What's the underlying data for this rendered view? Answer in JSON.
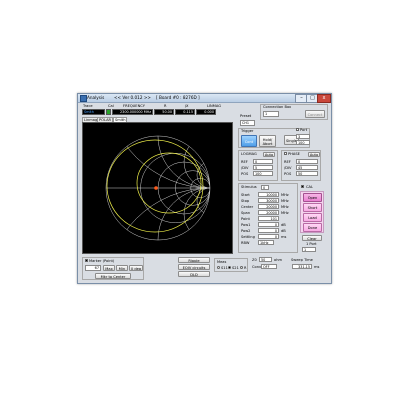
{
  "window": {
    "title": "Analysis",
    "version": "<< Ver 0.012 >>",
    "board": "[ Board #0 : 8276D ]",
    "minimize": "–",
    "maximize": "□",
    "close": "x"
  },
  "readout": {
    "headers": [
      "Trace",
      "Cal",
      "FREQUENCY",
      "R",
      "jX",
      "LINMAG"
    ],
    "values": [
      "Smith",
      "",
      "2300.000000 MHz",
      "50.00",
      "0.115",
      "0.000"
    ]
  },
  "tabs": [
    "Linmag",
    "POLAR",
    "Smith"
  ],
  "connection_box": {
    "title": "Connection Box",
    "select_value": "1",
    "button": "Connect"
  },
  "preset": {
    "label": "Preset",
    "value": "CH1"
  },
  "trigger": {
    "title": "Trigger",
    "cont": "Cont",
    "hold": "Hold/ Abort",
    "single": "Single",
    "port_label": "Port",
    "count": "3",
    "count2": "100"
  },
  "logmag": {
    "title": "LOGMAG",
    "auto": "Auto",
    "ref_label": "REF",
    "ref_value": "0",
    "div_label": "/DIV",
    "div_value": "5",
    "pos_label": "POS",
    "pos_value": "100"
  },
  "phase": {
    "title": "PHASE",
    "auto": "Auto",
    "ref_label": "REF",
    "ref_value": "0",
    "div_label": "/DIV",
    "div_value": "45",
    "pos_label": "POS",
    "pos_value": "50"
  },
  "stimulus": {
    "title": "Stimulus",
    "select_value": "0",
    "rows": [
      {
        "label": "Start",
        "value": "10000",
        "unit": "MHz"
      },
      {
        "label": "Stop",
        "value": "30000",
        "unit": "MHz"
      },
      {
        "label": "Center",
        "value": "20000",
        "unit": "MHz"
      },
      {
        "label": "Span",
        "value": "20000",
        "unit": "MHz"
      },
      {
        "label": "Point",
        "value": "101",
        "unit": ""
      },
      {
        "label": "Pow1",
        "value": "0",
        "unit": "dB"
      },
      {
        "label": "Pow2",
        "value": "0",
        "unit": "dB"
      },
      {
        "label": "Settling",
        "value": "0",
        "unit": "ms"
      },
      {
        "label": "RBW",
        "value": "1kHz",
        "unit": ""
      }
    ]
  },
  "cal": {
    "title": "CAL",
    "buttons": [
      "Open",
      "Short",
      "Load",
      "Done"
    ],
    "clear": "Clear",
    "port_label": "1 Port",
    "port_value": "1"
  },
  "marker": {
    "title": "Marker (Point)",
    "value": "67",
    "buttons": [
      "Max",
      "Min",
      "0 deg"
    ],
    "center_button": "Mkr to Center"
  },
  "ripple": {
    "ripple_button": "Ripple",
    "eqiv_button": "EQIV circuits",
    "dld_button": "DLD"
  },
  "meas": {
    "title": "Meas",
    "options": [
      "S11",
      "S21",
      "R"
    ]
  },
  "z0": {
    "label": "Z0",
    "value": "50",
    "unit": "ohm"
  },
  "conv": {
    "label": "Conv",
    "value": "OFF"
  },
  "sweep_time": {
    "label": "Sweep Time",
    "value": "331.15",
    "unit": "ms"
  },
  "colors": {
    "smith_grid": "#cfcfcf",
    "trace": "#f0f04a",
    "marker": "#ff5a1a",
    "cal_pink": "#f7a9e3",
    "trigger_blue": "#4e9ee8"
  },
  "icons": [
    "app-icon",
    "minimize-icon",
    "maximize-icon",
    "close-icon"
  ]
}
